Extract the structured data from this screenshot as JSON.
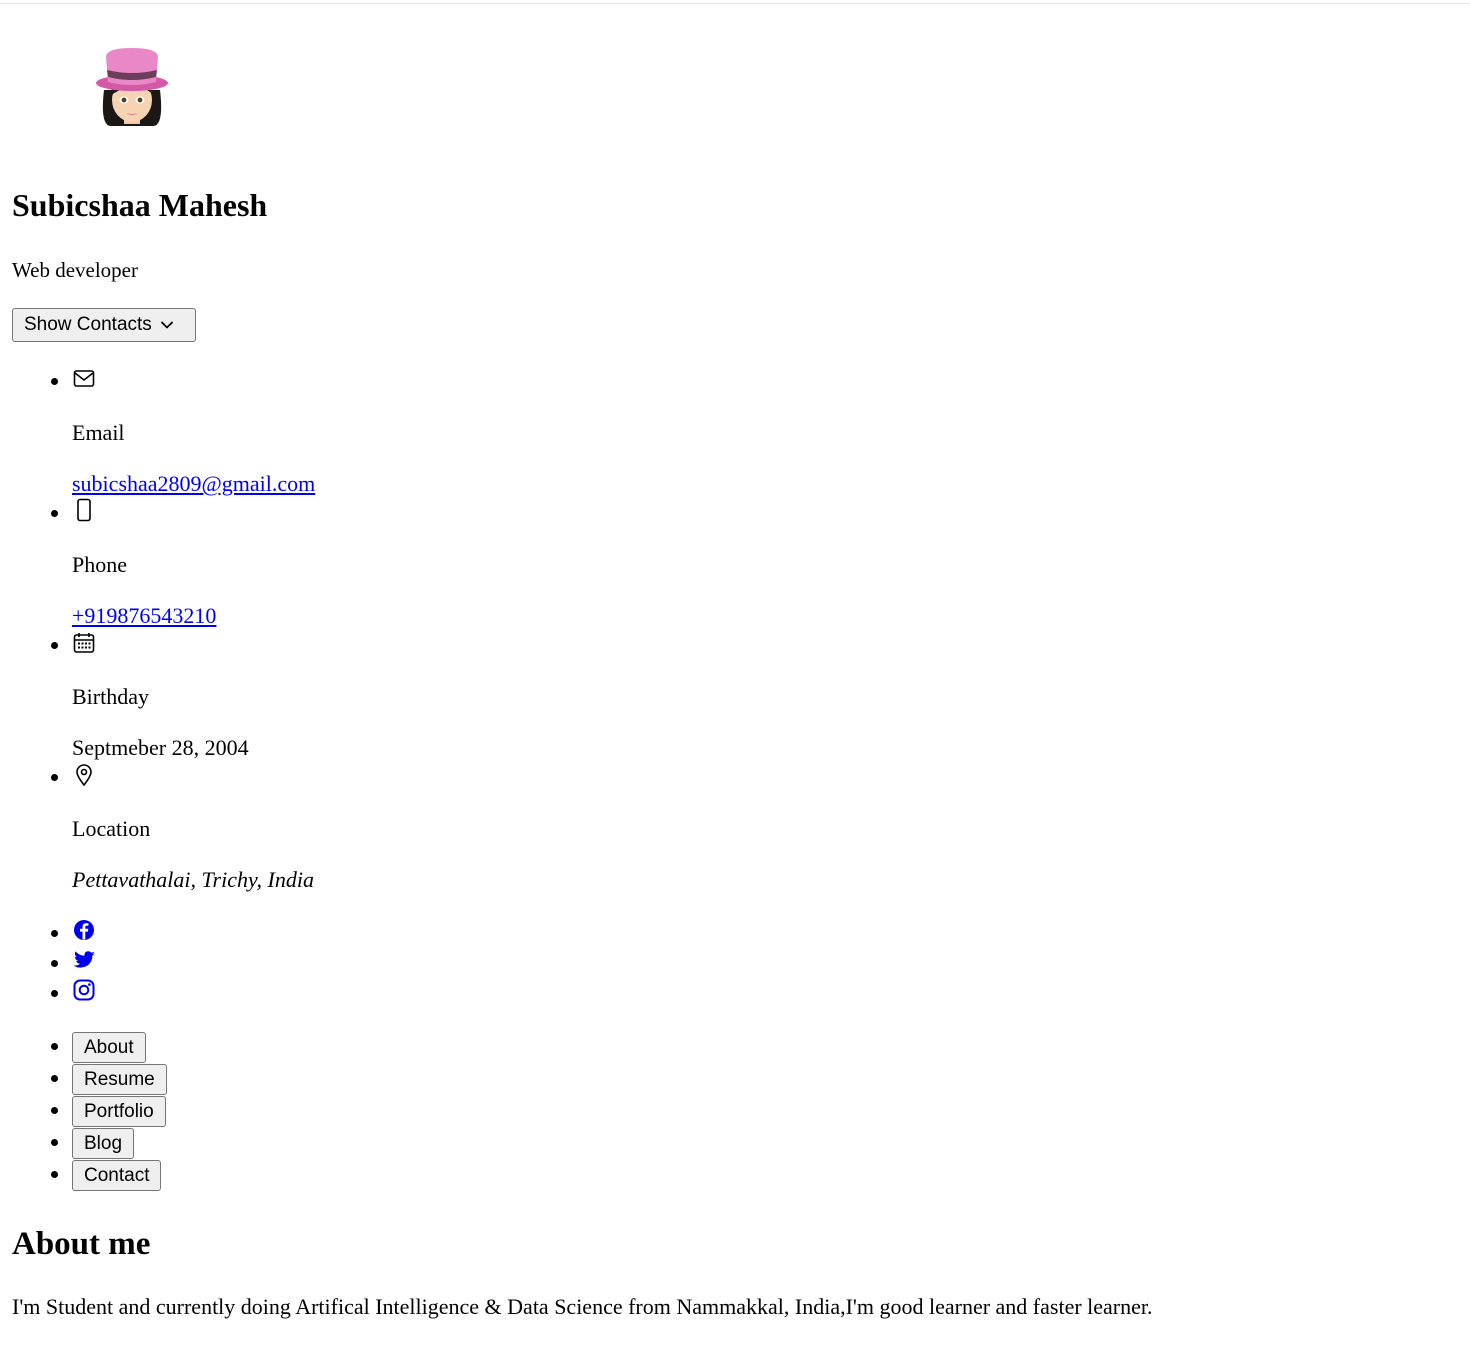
{
  "profile": {
    "name": "Subicshaa Mahesh",
    "title": "Web developer",
    "avatar_icon": "memoji-avatar-pink-hat"
  },
  "contacts_toggle": {
    "label": "Show Contacts",
    "icon": "chevron-down-icon"
  },
  "contacts": {
    "email": {
      "label": "Email",
      "value": "subicshaa2809@gmail.com",
      "icon": "mail-icon"
    },
    "phone": {
      "label": "Phone",
      "value": "+919876543210",
      "icon": "smartphone-icon"
    },
    "birthday": {
      "label": "Birthday",
      "value": "Septmeber 28, 2004",
      "icon": "calendar-icon"
    },
    "location": {
      "label": "Location",
      "value": "Pettavathalai, Trichy, India",
      "icon": "location-pin-icon"
    }
  },
  "social": [
    "facebook-icon",
    "twitter-icon",
    "instagram-icon"
  ],
  "nav": {
    "about": "About",
    "resume": "Resume",
    "portfolio": "Portfolio",
    "blog": "Blog",
    "contact": "Contact"
  },
  "about": {
    "heading": "About me",
    "text": "I'm Student and currently doing Artifical Intelligence & Data Science from Nammakkal, India,I'm good learner and faster learner."
  },
  "colors": {
    "link": "#0000ee",
    "button_bg": "#efefef",
    "button_border": "#767676",
    "hat": "#e06bb8"
  }
}
